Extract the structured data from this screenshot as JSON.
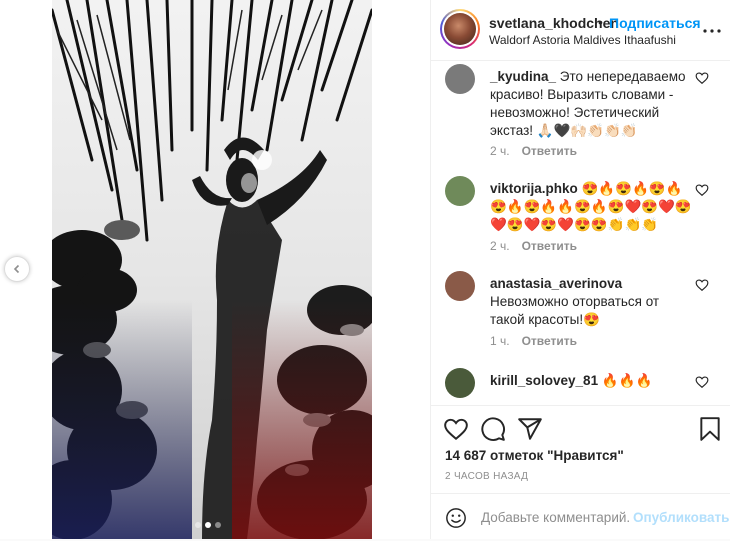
{
  "post": {
    "username": "svetlana_khodchen",
    "separator": "•",
    "follow_label": "Подписаться",
    "location": "Waldorf Astoria Maldives Ithaafushi"
  },
  "carousel": {
    "slide_count": 3,
    "active_slide": 1
  },
  "comments": [
    {
      "username": "_kyudina_",
      "text": "Это непередаваемо красиво! Выразить словами - невозможно! Эстетический экстаз! 🙏🏻🖤🙌🏻👏🏻👏🏻👏🏻",
      "time": "2 ч.",
      "reply_label": "Ответить",
      "avatar_color": "#7a7a7a"
    },
    {
      "username": "viktorija.phko",
      "text": "😍🔥😍🔥😍🔥😍🔥😍🔥🔥😍🔥😍❤️😍❤️😍❤️😍❤️😍❤️😍😍👏👏👏",
      "time": "2 ч.",
      "reply_label": "Ответить",
      "avatar_color": "#6f8a5a"
    },
    {
      "username": "anastasia_averinova",
      "text": "Невозможно оторваться от такой красоты!😍",
      "time": "1 ч.",
      "reply_label": "Ответить",
      "avatar_color": "#8a5a48"
    },
    {
      "username": "kirill_solovey_81",
      "text": "🔥🔥🔥",
      "time": "",
      "reply_label": "",
      "avatar_color": "#4a5a3a"
    }
  ],
  "actions": {
    "likes_text": "14 687 отметок \"Нравится\"",
    "timestamp": "2 ЧАСОВ НАЗАД",
    "comment_placeholder": "Добавьте комментарий...",
    "publish_label": "Опубликовать"
  },
  "icons": [
    "chevron-left-icon",
    "more-icon",
    "heart-icon",
    "comment-icon",
    "share-icon",
    "bookmark-icon",
    "emoji-icon"
  ]
}
